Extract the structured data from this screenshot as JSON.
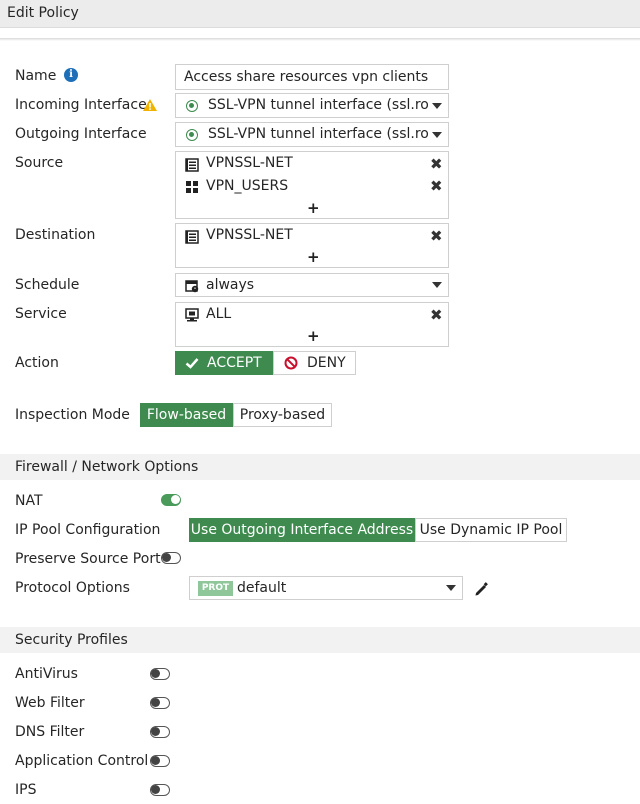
{
  "header": {
    "title": "Edit Policy"
  },
  "form": {
    "name": {
      "label": "Name",
      "value": "Access share resources vpn clients"
    },
    "incoming": {
      "label": "Incoming Interface",
      "value": "SSL-VPN tunnel interface (ssl.root)"
    },
    "outgoing": {
      "label": "Outgoing Interface",
      "value": "SSL-VPN tunnel interface (ssl.root)"
    },
    "source": {
      "label": "Source",
      "items": [
        "VPNSSL-NET",
        "VPN_USERS"
      ],
      "add": "+"
    },
    "destination": {
      "label": "Destination",
      "items": [
        "VPNSSL-NET"
      ],
      "add": "+"
    },
    "schedule": {
      "label": "Schedule",
      "value": "always"
    },
    "service": {
      "label": "Service",
      "items": [
        "ALL"
      ],
      "add": "+"
    },
    "action": {
      "label": "Action",
      "accept": "ACCEPT",
      "deny": "DENY",
      "selected": "ACCEPT"
    },
    "inspection": {
      "label": "Inspection Mode",
      "flow": "Flow-based",
      "proxy": "Proxy-based",
      "selected": "Flow-based"
    }
  },
  "firewall": {
    "title": "Firewall / Network Options",
    "nat": {
      "label": "NAT",
      "enabled": true
    },
    "ip_pool": {
      "label": "IP Pool Configuration",
      "option1": "Use Outgoing Interface Address",
      "option2": "Use Dynamic IP Pool",
      "selected": "Use Outgoing Interface Address"
    },
    "preserve": {
      "label": "Preserve Source Port",
      "enabled": false
    },
    "protocol": {
      "label": "Protocol Options",
      "badge": "PROT",
      "value": "default"
    }
  },
  "security": {
    "title": "Security Profiles",
    "items": [
      {
        "label": "AntiVirus",
        "enabled": false
      },
      {
        "label": "Web Filter",
        "enabled": false
      },
      {
        "label": "DNS Filter",
        "enabled": false
      },
      {
        "label": "Application Control",
        "enabled": false
      },
      {
        "label": "IPS",
        "enabled": false
      }
    ]
  },
  "colors": {
    "accent": "#3f8b4f",
    "deny": "#c8102e",
    "info": "#1e6fb8",
    "warning": "#f0b400"
  }
}
